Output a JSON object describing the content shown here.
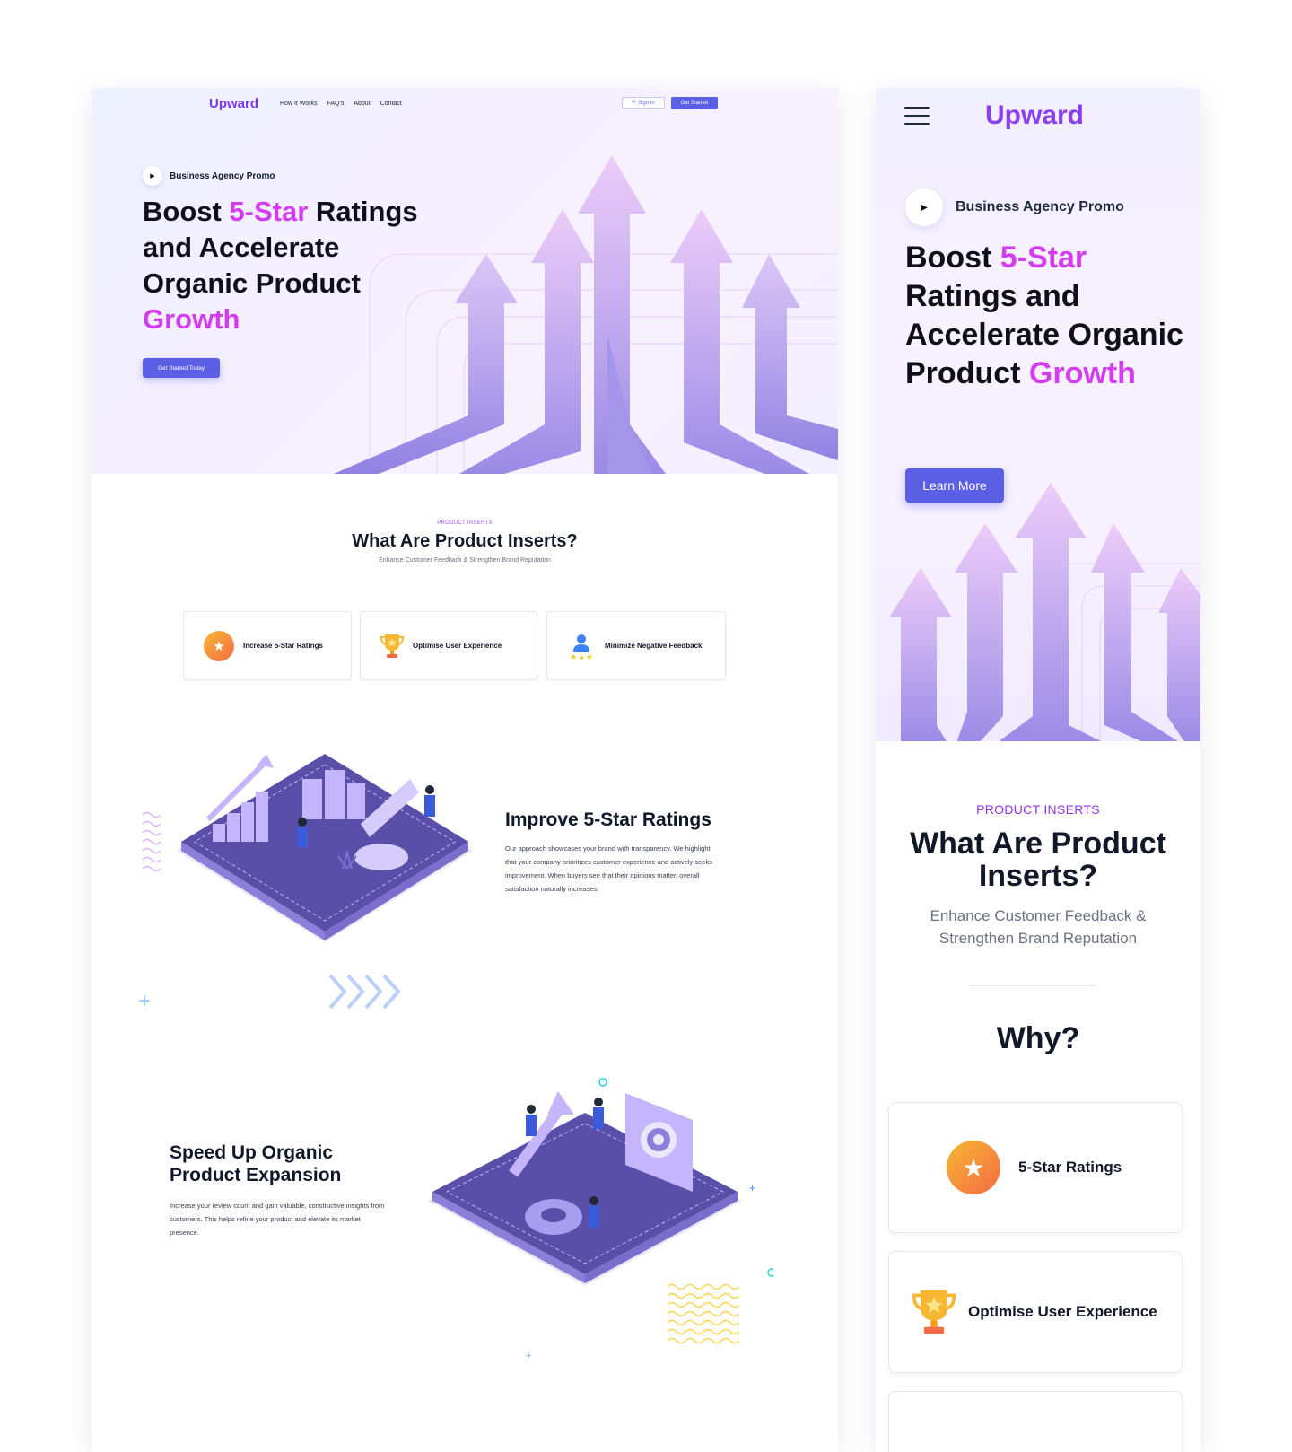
{
  "desktop": {
    "nav": {
      "logo": "Upward",
      "links": [
        "How It Works",
        "FAQ's",
        "About",
        "Contact"
      ],
      "signin_label": "Sign In",
      "getstarted_label": "Get Started"
    },
    "hero": {
      "promo": "Business Agency Promo",
      "headline_pre": "Boost ",
      "headline_accent": "5-Star",
      "headline_mid": " Ratings and Accelerate Organic Product ",
      "headline_accent2": "Growth",
      "cta": "Get Started Today"
    },
    "inserts": {
      "eyebrow": "PRODUCT INSERTS",
      "title": "What Are Product Inserts?",
      "subtitle": "Enhance Customer Feedback & Strengthen Brand Reputation",
      "features": [
        {
          "label": "Increase 5-Star Ratings",
          "icon": "star-badge-icon"
        },
        {
          "label": "Optimise User Experience",
          "icon": "trophy-icon"
        },
        {
          "label": "Minimize Negative Feedback",
          "icon": "user-stars-icon"
        }
      ]
    },
    "block1": {
      "title": "Improve 5-Star Ratings",
      "text": "Our approach showcases your brand with transparency. We highlight that your company prioritizes customer experience and actively seeks improvement. When buyers see that their opinions matter, overall satisfaction naturally increases."
    },
    "block2": {
      "title": "Speed Up Organic Product Expansion",
      "text": "Increase your review count and gain valuable, constructive insights from customers. This helps refine your product and elevate its market presence."
    }
  },
  "mobile": {
    "logo": "Upward",
    "promo": "Business Agency Promo",
    "headline_pre": "Boost ",
    "headline_accent": "5-Star",
    "headline_mid": " Ratings and Accelerate Organic Product ",
    "headline_accent2": "Growth",
    "cta": "Learn More",
    "eyebrow": "PRODUCT INSERTS",
    "title": "What Are Product Inserts?",
    "subtitle": "Enhance Customer Feedback & Strengthen Brand Reputation",
    "why": "Why?",
    "cards": [
      {
        "label": "5-Star Ratings",
        "icon": "star-badge-icon"
      },
      {
        "label": "Optimise User Experience",
        "icon": "trophy-icon"
      }
    ]
  },
  "colors": {
    "brand": "#7c3aed",
    "accent": "#d33cf0",
    "button": "#5b5fe6",
    "arrow_light": "#e6c9f7",
    "arrow_dark": "#9b8ce8",
    "isometric_base": "#5a4fa8"
  }
}
